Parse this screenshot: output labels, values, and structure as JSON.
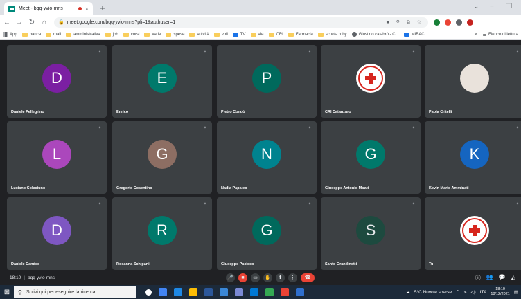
{
  "browser": {
    "tab_title": "Meet - bqq-yvio-mns",
    "close_glyph": "×",
    "new_tab_glyph": "+",
    "url": "meet.google.com/bqq-yvio-mns?pli=1&authuser=1",
    "window_controls": [
      "⌄",
      "−",
      "❐"
    ]
  },
  "bookmarks": {
    "items": [
      "App",
      "banca",
      "mail",
      "amministrativa",
      "job",
      "corsi",
      "varie",
      "spese",
      "attività",
      "voli",
      "TV",
      "ale",
      "CRI",
      "Farmacia",
      "scuola roby",
      "Giustino calabrò - C...",
      "MIBAC"
    ],
    "overflow": "»",
    "reading_list": "Elenco di lettura"
  },
  "participants": [
    {
      "name": "Daniele Pellegrino",
      "initial": "D",
      "color": "#7b1fa2",
      "kind": "letter"
    },
    {
      "name": "Enrico",
      "initial": "E",
      "color": "#00796b",
      "kind": "letter"
    },
    {
      "name": "Pietro Condò",
      "initial": "P",
      "color": "#00695c",
      "kind": "letter"
    },
    {
      "name": "CRI Catanzaro",
      "initial": "",
      "color": "#ffffff",
      "kind": "cri"
    },
    {
      "name": "Paola Critelli",
      "initial": "",
      "color": "#e9e2db",
      "kind": "photo"
    },
    {
      "name": "Luciano Colaciuno",
      "initial": "L",
      "color": "#ab47bc",
      "kind": "letter"
    },
    {
      "name": "Gregorio Cosentino",
      "initial": "G",
      "color": "#8d6e63",
      "kind": "letter"
    },
    {
      "name": "Nadia Papaleo",
      "initial": "N",
      "color": "#00838f",
      "kind": "letter"
    },
    {
      "name": "Giuseppe Antonio Mazzi",
      "initial": "G",
      "color": "#00796b",
      "kind": "letter"
    },
    {
      "name": "Kevin Mario Amminati",
      "initial": "K",
      "color": "#1565c0",
      "kind": "letter"
    },
    {
      "name": "Daniele Candeo",
      "initial": "D",
      "color": "#7e57c2",
      "kind": "letter"
    },
    {
      "name": "Rosanna Schipani",
      "initial": "R",
      "color": "#00796b",
      "kind": "letter"
    },
    {
      "name": "Giuseppe Pacicco",
      "initial": "G",
      "color": "#00695c",
      "kind": "letter"
    },
    {
      "name": "Santo Grandinetti",
      "initial": "S",
      "color": "#1d4a3f",
      "kind": "sphoto"
    },
    {
      "name": "Tu",
      "initial": "",
      "color": "#ffffff",
      "kind": "cri"
    }
  ],
  "meeting": {
    "time": "18:10",
    "separator": "|",
    "code": "bqq-yvio-mns"
  },
  "taskbar": {
    "search_placeholder": "Scrivi qui per eseguire la ricerca",
    "weather": "5°C  Nuvole sparse",
    "language": "ITA",
    "clock_time": "18:10",
    "clock_date": "18/12/2021"
  }
}
